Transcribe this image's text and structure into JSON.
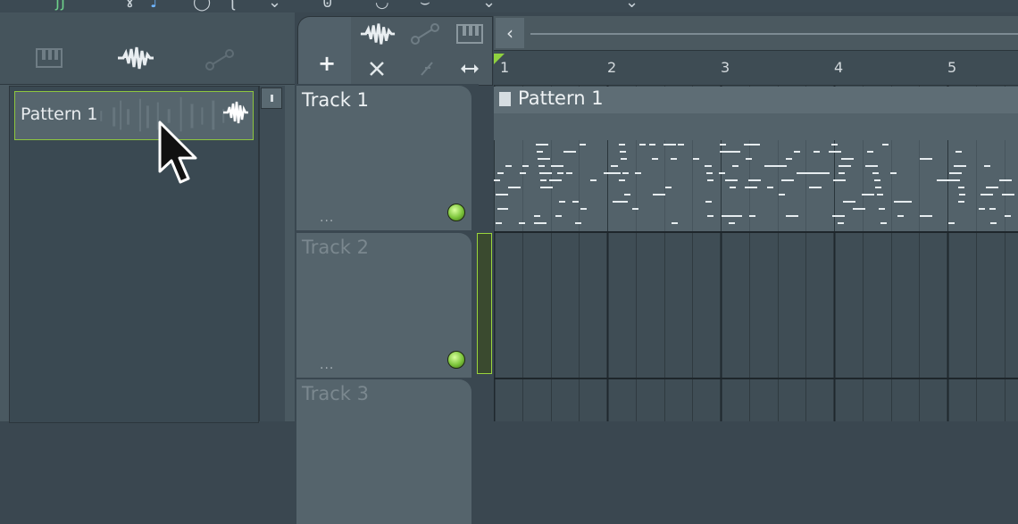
{
  "browser": {
    "tabs": [
      {
        "icon": "piano-icon"
      },
      {
        "icon": "audio-wave-icon"
      },
      {
        "icon": "automation-icon"
      }
    ],
    "pattern_item": {
      "label": "Pattern 1",
      "icon": "audio-wave-icon"
    }
  },
  "tools": {
    "add_label": "+",
    "row1": [
      "audio-wave-icon",
      "automation-icon",
      "piano-icon"
    ],
    "row2": [
      "close-icon",
      "slash-icon",
      "resize-icon"
    ]
  },
  "tracks": [
    {
      "label": "Track 1",
      "dots": "..."
    },
    {
      "label": "Track 2",
      "dots": "..."
    },
    {
      "label": "Track 3",
      "dots": ""
    }
  ],
  "ruler": {
    "bars": [
      "1",
      "2",
      "3",
      "4",
      "5"
    ]
  },
  "clip": {
    "title": "Pattern 1"
  },
  "colors": {
    "accent": "#8ec63f",
    "panel": "#4a5961",
    "track": "#55646c"
  }
}
